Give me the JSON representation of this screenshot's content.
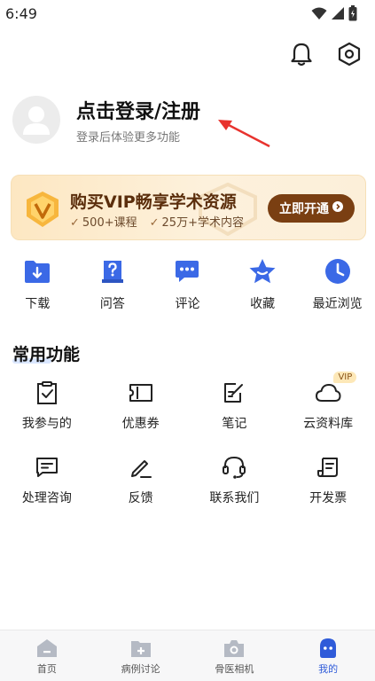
{
  "status_bar": {
    "time": "6:49"
  },
  "profile": {
    "login_title": "点击登录/注册",
    "login_subtitle": "登录后体验更多功能"
  },
  "vip": {
    "title": "购买VIP畅享学术资源",
    "perks": [
      "500+课程",
      "25万+学术内容"
    ],
    "button_label": "立即开通",
    "accent_color": "#7a3f12"
  },
  "quick_actions": [
    {
      "label": "下载",
      "icon": "download-folder-icon"
    },
    {
      "label": "问答",
      "icon": "question-book-icon"
    },
    {
      "label": "评论",
      "icon": "comment-bubble-icon"
    },
    {
      "label": "收藏",
      "icon": "star-icon"
    },
    {
      "label": "最近浏览",
      "icon": "clock-icon"
    }
  ],
  "common_functions": {
    "title": "常用功能",
    "items": [
      {
        "label": "我参与的",
        "icon": "clipboard-check-icon"
      },
      {
        "label": "优惠券",
        "icon": "coupon-icon"
      },
      {
        "label": "笔记",
        "icon": "note-edit-icon"
      },
      {
        "label": "云资料库",
        "icon": "cloud-icon",
        "badge": "VIP"
      },
      {
        "label": "处理咨询",
        "icon": "message-icon"
      },
      {
        "label": "反馈",
        "icon": "pencil-icon"
      },
      {
        "label": "联系我们",
        "icon": "headset-icon"
      },
      {
        "label": "开发票",
        "icon": "invoice-icon"
      }
    ]
  },
  "tabbar": {
    "tabs": [
      {
        "label": "首页",
        "icon": "home-icon"
      },
      {
        "label": "病例讨论",
        "icon": "case-folder-icon"
      },
      {
        "label": "骨医相机",
        "icon": "camera-icon"
      },
      {
        "label": "我的",
        "icon": "profile-icon",
        "active": true
      }
    ],
    "active_color": "#2f5bd9"
  }
}
